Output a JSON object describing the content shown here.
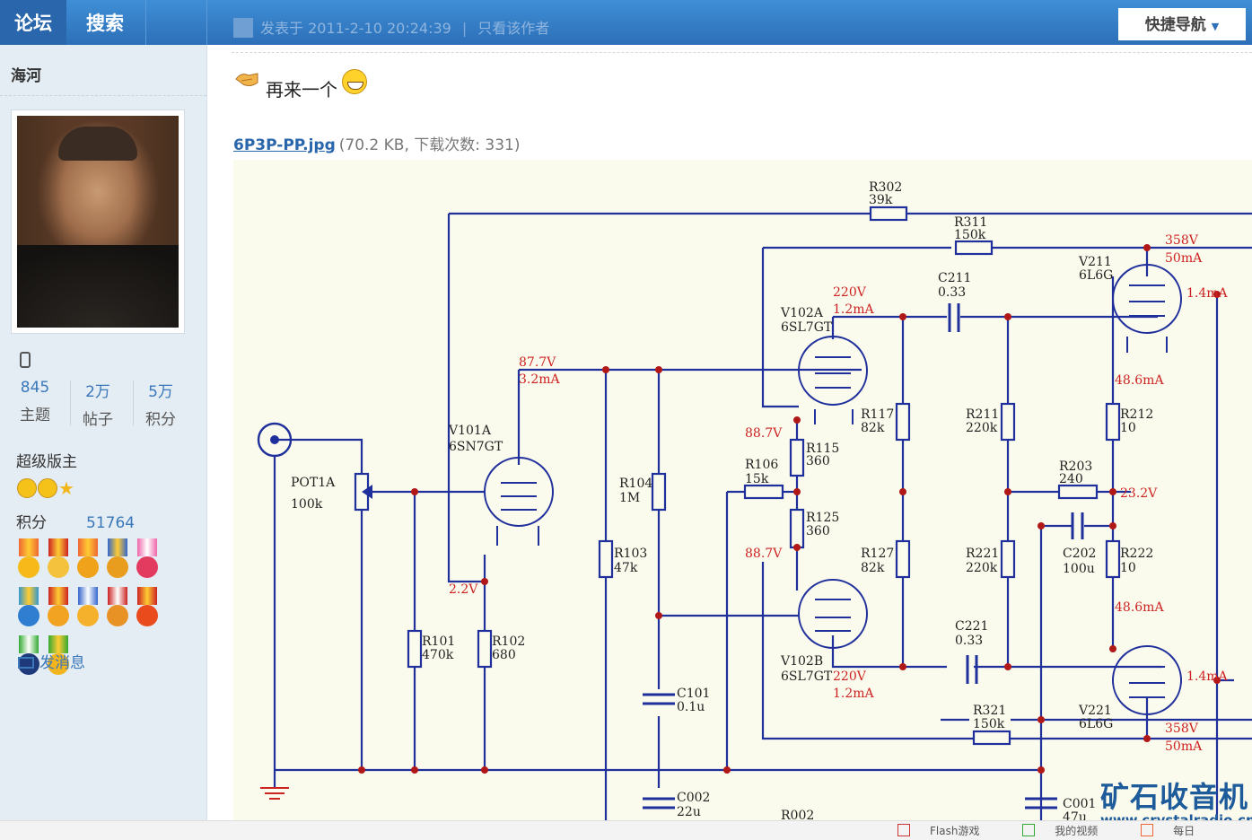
{
  "tabs": [
    {
      "label": "论坛",
      "active": true
    },
    {
      "label": "搜索",
      "active": false
    }
  ],
  "post_meta": {
    "posted_at": "发表于 2011-2-10 20:24:39",
    "only_author": "只看该作者"
  },
  "quick_nav": "快捷导航",
  "user": {
    "name": "海河",
    "stats": [
      {
        "value": "845",
        "label": "主题"
      },
      {
        "value": "2万",
        "label": "帖子"
      },
      {
        "value": "5万",
        "label": "积分"
      }
    ],
    "rank": "超级版主",
    "points_label": "积分",
    "points_value": "51764",
    "send_message": "发消息"
  },
  "post": {
    "text": "再来一个",
    "attachment_name": "6P3P-PP.jpg",
    "attachment_info": "(70.2 KB, 下载次数: 331)"
  },
  "schematic_labels": {
    "r302": "R302",
    "r302v": "39k",
    "r311": "R311",
    "r311v": "150k",
    "v211": "V211",
    "v211t": "6L6G",
    "v211v": "358V",
    "v211a": "50mA",
    "c211": "C211",
    "c211v": "0.33",
    "v102a": "V102A",
    "v102at": "6SL7GT",
    "v102a_v": "220V",
    "v102a_a": "1.2mA",
    "a14": "1.4mA",
    "v101v": "87.7V",
    "v101a": "3.2mA",
    "v101": "V101A",
    "v101t": "6SN7GT",
    "a486": "48.6mA",
    "r117": "R117",
    "r117v": "82k",
    "r211": "R211",
    "r211v": "220k",
    "r212": "R212",
    "r212v": "10",
    "v887": "88.7V",
    "r115": "R115",
    "r115v": "360",
    "r106": "R106",
    "r106v": "15k",
    "r104": "R104",
    "r104v": "1M",
    "pot": "POT1A",
    "potv": "100k",
    "r203": "R203",
    "r203v": "240",
    "v232": "23.2V",
    "r125": "R125",
    "r125v": "360",
    "r103": "R103",
    "r103v": "47k",
    "r127": "R127",
    "r127v": "82k",
    "r221": "R221",
    "r221v": "220k",
    "c202": "C202",
    "c202v": "100u",
    "r222": "R222",
    "r222v": "10",
    "v22": "2.2V",
    "c221": "C221",
    "c221v": "0.33",
    "v102b": "V102B",
    "v102bt": "6SL7GT",
    "v102b_v": "220V",
    "v102b_a": "1.2mA",
    "r101": "R101",
    "r101v": "470k",
    "r102": "R102",
    "r102v": "680",
    "c101": "C101",
    "c101v": "0.1u",
    "r321": "R321",
    "r321v": "150k",
    "v221": "V221",
    "v221t": "6L6G",
    "v221v": "358V",
    "v221a": "50mA",
    "c002": "C002",
    "c002v": "22u",
    "r002": "R002",
    "c001": "C001",
    "c001v": "47u"
  },
  "watermark": {
    "name": "矿石收音机",
    "url": "www.crystalradio.cn"
  },
  "bottom_links": [
    "Flash游戏",
    "我的视频",
    "每日"
  ],
  "colors": {
    "topbar": "#2c6fb8",
    "sidebar": "#e5edf4",
    "wire": "#1f2f9c",
    "annotation": "#cc2222",
    "link": "#3a78b9"
  }
}
